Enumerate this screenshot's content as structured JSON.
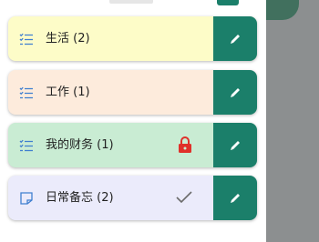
{
  "accent_color": "#1b7f6a",
  "notebooks": [
    {
      "label": "生活 (2)",
      "bg": "#fdfcc8",
      "icon": "checklist-icon",
      "status": "none"
    },
    {
      "label": "工作 (1)",
      "bg": "#fdebdc",
      "icon": "checklist-icon",
      "status": "none"
    },
    {
      "label": "我的财务 (1)",
      "bg": "#c9ecd3",
      "icon": "checklist-icon",
      "status": "lock-icon"
    },
    {
      "label": "日常备忘 (2)",
      "bg": "#ebebfb",
      "icon": "note-icon",
      "status": "check-icon"
    }
  ],
  "edit_icon": "pencil-icon"
}
